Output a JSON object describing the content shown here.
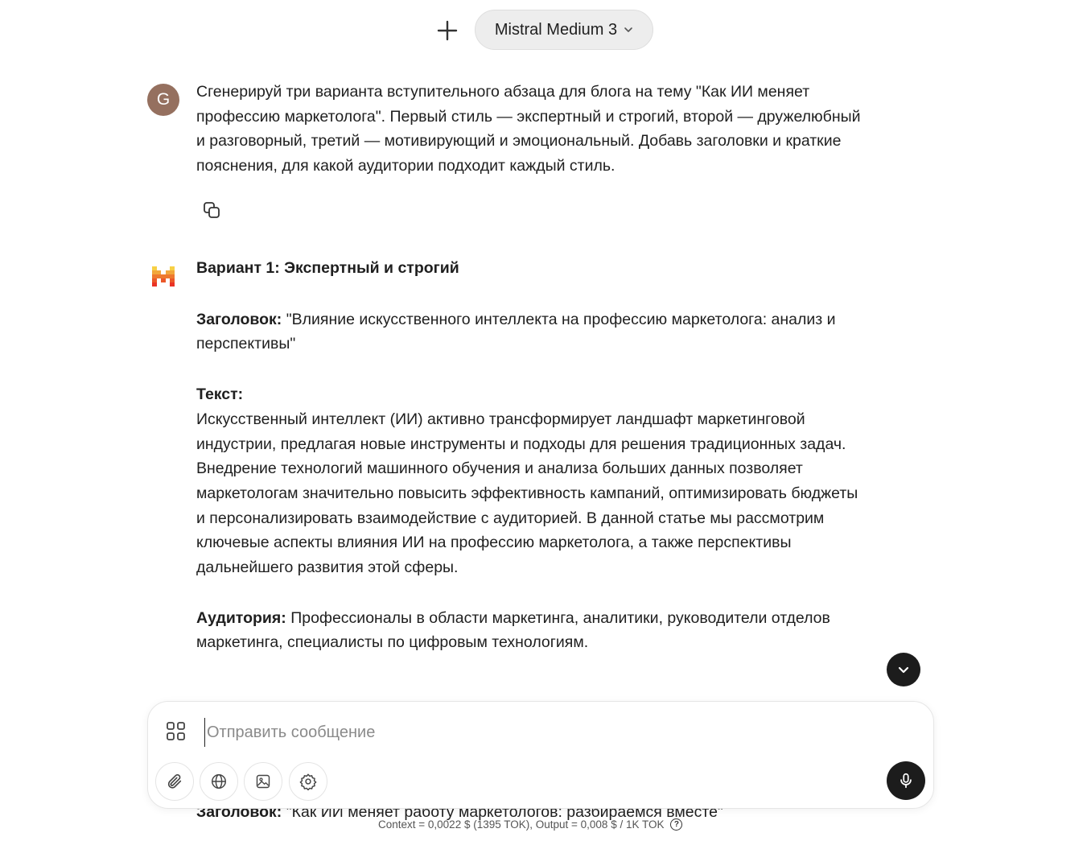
{
  "header": {
    "model_name": "Mistral Medium 3"
  },
  "user_message": {
    "avatar_letter": "G",
    "text": "Сгенерируй три варианта вступительного абзаца для блога на тему \"Как ИИ меняет профессию маркетолога\". Первый стиль — экспертный и строгий, второй — дружелюбный и разговорный, третий — мотивирующий и эмоциональный. Добавь заголовки и краткие пояснения, для какой аудитории подходит каждый стиль."
  },
  "assistant_message": {
    "variant_title": "Вариант 1: Экспертный и строгий",
    "heading_label": "Заголовок:",
    "heading_value": " \"Влияние искусственного интеллекта на профессию маркетолога: анализ и перспективы\"",
    "text_label": "Текст:",
    "text_value": "Искусственный интеллект (ИИ) активно трансформирует ландшафт маркетинговой индустрии, предлагая новые инструменты и подходы для решения традиционных задач. Внедрение технологий машинного обучения и анализа больших данных позволяет маркетологам значительно повысить эффективность кампаний, оптимизировать бюджеты и персонализировать взаимодействие с аудиторией. В данной статье мы рассмотрим ключевые аспекты влияния ИИ на профессию маркетолога, а также перспективы дальнейшего развития этой сферы.",
    "audience_label": "Аудитория:",
    "audience_value": " Профессионалы в области маркетинга, аналитики, руководители отделов маркетинга, специалисты по цифровым технологиям.",
    "peek_label": "Заголовок:",
    "peek_value": " \"Как ИИ меняет работу маркетологов: разбираемся вместе\""
  },
  "composer": {
    "placeholder": "Отправить сообщение",
    "value": ""
  },
  "footer": {
    "cost_text": "Context = 0,0022 $ (1395 TOK), Output = 0,008 $ / 1K TOK"
  },
  "colors": {
    "user_avatar": "#95705f",
    "dark_button": "#1c1c1c",
    "pill_bg": "#ededed"
  }
}
